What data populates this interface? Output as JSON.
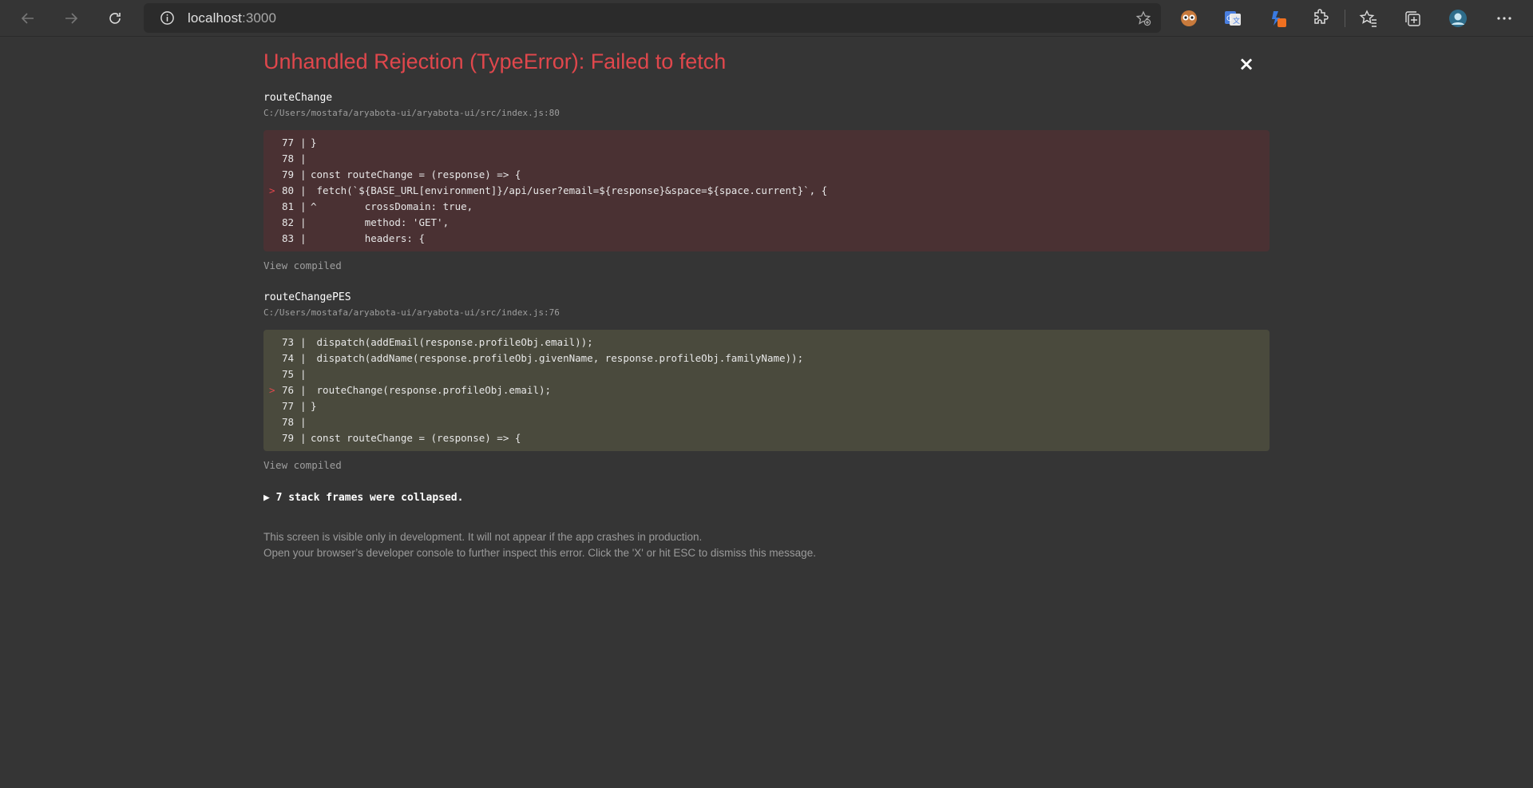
{
  "browser": {
    "url_host": "localhost",
    "url_port": ":3000"
  },
  "error": {
    "title": "Unhandled Rejection (TypeError): Failed to fetch",
    "close_label": "×",
    "frames": [
      {
        "name": "routeChange",
        "file": "C:/Users/mostafa/aryabota-ui/aryabota-ui/src/index.js:80",
        "lines": [
          {
            "num": "77",
            "marked": false,
            "text": "}"
          },
          {
            "num": "78",
            "marked": false,
            "text": ""
          },
          {
            "num": "79",
            "marked": false,
            "text": "const routeChange = (response) => {"
          },
          {
            "num": "80",
            "marked": true,
            "text": " fetch(`${BASE_URL[environment]}/api/user?email=${response}&space=${space.current}`, {"
          },
          {
            "num": "81",
            "marked": false,
            "text": "^        crossDomain: true,"
          },
          {
            "num": "82",
            "marked": false,
            "text": "         method: 'GET',"
          },
          {
            "num": "83",
            "marked": false,
            "text": "         headers: {"
          }
        ],
        "view_compiled": "View compiled"
      },
      {
        "name": "routeChangePES",
        "file": "C:/Users/mostafa/aryabota-ui/aryabota-ui/src/index.js:76",
        "lines": [
          {
            "num": "73",
            "marked": false,
            "text": " dispatch(addEmail(response.profileObj.email));"
          },
          {
            "num": "74",
            "marked": false,
            "text": " dispatch(addName(response.profileObj.givenName, response.profileObj.familyName));"
          },
          {
            "num": "75",
            "marked": false,
            "text": ""
          },
          {
            "num": "76",
            "marked": true,
            "text": " routeChange(response.profileObj.email);"
          },
          {
            "num": "77",
            "marked": false,
            "text": "}"
          },
          {
            "num": "78",
            "marked": false,
            "text": ""
          },
          {
            "num": "79",
            "marked": false,
            "text": "const routeChange = (response) => {"
          }
        ],
        "view_compiled": "View compiled"
      }
    ],
    "collapsed_text": "▶ 7 stack frames were collapsed.",
    "footer_line1": "This screen is visible only in development. It will not appear if the app crashes in production.",
    "footer_line2": "Open your browser’s developer console to further inspect this error.  Click the 'X' or hit ESC to dismiss this message."
  }
}
